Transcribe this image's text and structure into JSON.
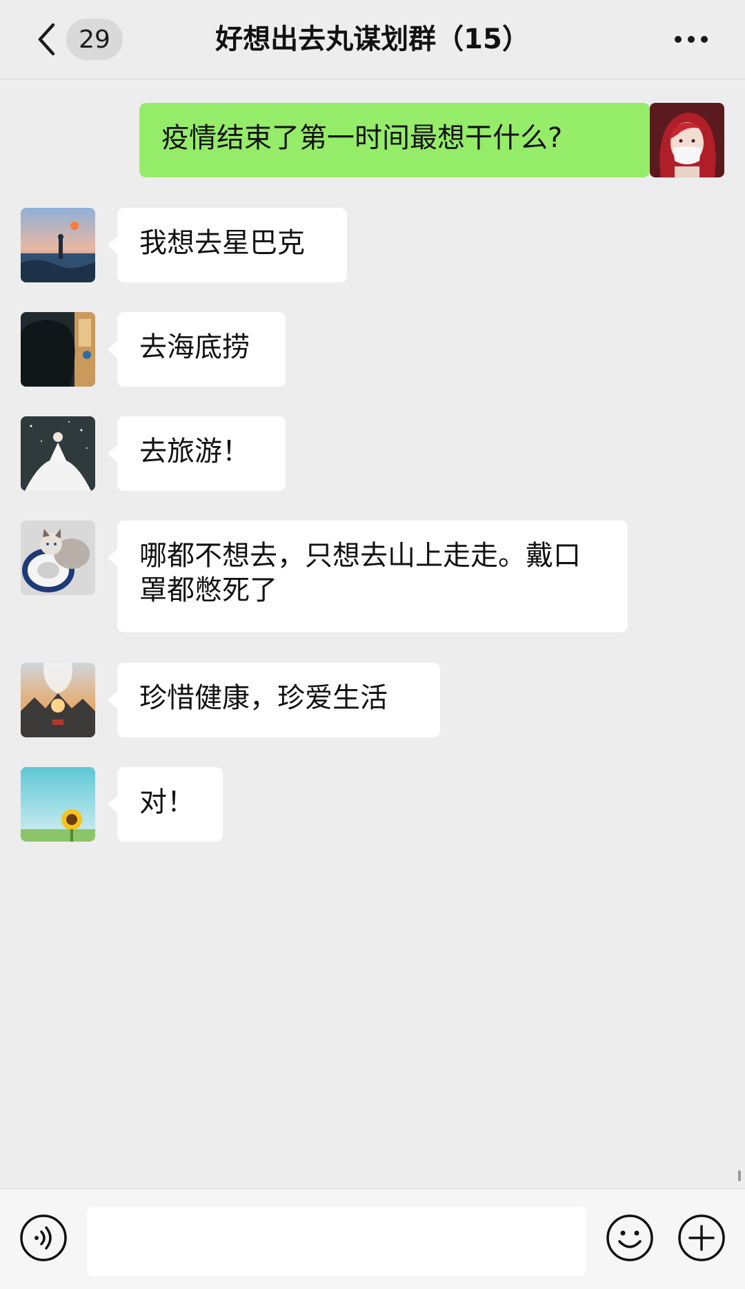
{
  "header": {
    "unread_count": "29",
    "title": "好想出去丸谋划群（15）"
  },
  "messages": [
    {
      "from": "self",
      "avatar": "red-hair-masked-woman-avatar",
      "text": "疫情结束了第一时间最想干什么?"
    },
    {
      "from": "other",
      "avatar": "sunset-sea-figure-avatar",
      "text": "我想去星巴克"
    },
    {
      "from": "other",
      "avatar": "dark-silhouette-window-avatar",
      "text": "去海底捞"
    },
    {
      "from": "other",
      "avatar": "bride-starry-sky-avatar",
      "text": "去旅游！"
    },
    {
      "from": "other",
      "avatar": "cat-life-buoy-avatar",
      "text": "哪都不想去，只想去山上走走。戴口罩都憋死了"
    },
    {
      "from": "other",
      "avatar": "double-exposure-mountain-avatar",
      "text": "珍惜健康，珍爱生活"
    },
    {
      "from": "other",
      "avatar": "sunflower-sky-avatar",
      "text": "对！"
    }
  ],
  "input": {
    "value": ""
  },
  "colors": {
    "background": "#ededed",
    "self_bubble": "#95ec69",
    "other_bubble": "#ffffff"
  }
}
